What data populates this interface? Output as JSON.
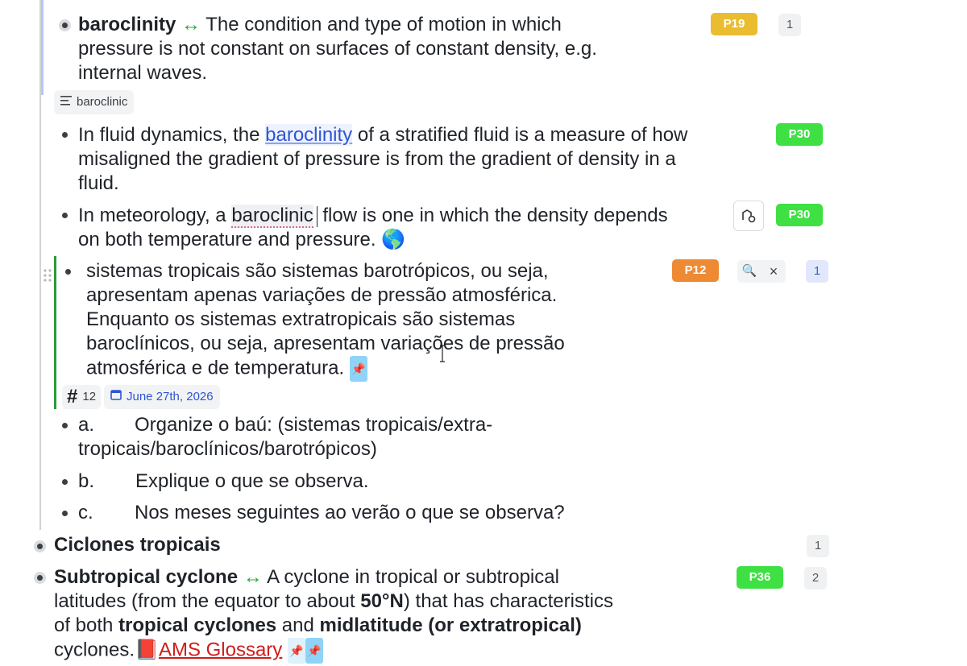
{
  "b1": {
    "term": "baroclinity",
    "arrow": "↔",
    "line1": " The condition and type of motion in which",
    "line2": "pressure is not constant on surfaces of constant density, e.g.",
    "line3": "internal waves.",
    "badge": "P19",
    "count": "1",
    "tag": "baroclinic"
  },
  "b2": {
    "pre": "In fluid dynamics, the ",
    "link": "baroclinity",
    "post": " of a stratified fluid is a measure of how",
    "line2": "misaligned the gradient of pressure is from the gradient of density in a",
    "line3": "fluid.",
    "badge": "P30"
  },
  "b3": {
    "pre": "In meteorology, a ",
    "word": "baroclinic",
    "post": " flow is one in which the density depends",
    "line2": "on both temperature and pressure. 🌎",
    "badge": "P30"
  },
  "b4": {
    "line1": "sistemas tropicais são sistemas barotrópicos, ou seja,",
    "line2": "apresentam apenas variações de pressão atmosférica.",
    "line3": "Enquanto os sistemas extratropicais são sistemas",
    "line4": "baroclínicos, ou seja, apresentam variações de pressão",
    "line5": "atmosférica e de temperatura.",
    "badge": "P12",
    "count": "1",
    "hash_count": "12",
    "date": "June 27th, 2026"
  },
  "b5": {
    "a_label": "a.",
    "a_text": "Organize o baú: (sistemas tropicais/extra-",
    "a_line2": "tropicais/baroclínicos/barotrópicos)",
    "b_label": "b.",
    "b_text": "Explique o que se observa.",
    "c_label": "c.",
    "c_text": "Nos meses seguintes ao verão o que se observa?"
  },
  "b6": {
    "title": "Ciclones tropicais",
    "count": "1"
  },
  "b7": {
    "term": "Subtropical cyclone",
    "arrow": "↔",
    "line1": " A cyclone in tropical or subtropical",
    "line2_pre": "latitudes (from the equator to about ",
    "line2_bold": "50°N",
    "line2_post": ") that has characteristics",
    "line3_pre": "of both ",
    "line3_bold1": "tropical cyclones",
    "line3_mid": " and ",
    "line3_bold2": "midlatitude (or extratropical)",
    "line4_pre": "cyclones.",
    "book": "📕",
    "link": "AMS Glossary",
    "badge": "P36",
    "count": "2"
  },
  "colors": {
    "yellow": "#e9bd2f",
    "green": "#3ee043",
    "orange": "#ee8a34"
  }
}
